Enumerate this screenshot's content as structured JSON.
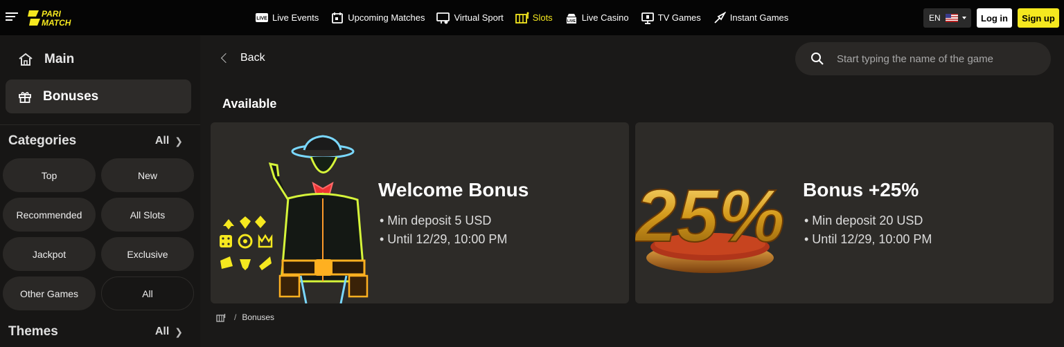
{
  "header": {
    "logo_text_line1": "PARI",
    "logo_text_line2": "MATCH",
    "nav": [
      {
        "label": "Live Events",
        "icon": "live-icon",
        "active": false
      },
      {
        "label": "Upcoming Matches",
        "icon": "calendar-icon",
        "active": false
      },
      {
        "label": "Virtual Sport",
        "icon": "virtual-sport-icon",
        "active": false
      },
      {
        "label": "Slots",
        "icon": "slots-icon",
        "active": true
      },
      {
        "label": "Live Casino",
        "icon": "live-casino-icon",
        "active": false
      },
      {
        "label": "TV Games",
        "icon": "tv-games-icon",
        "active": false
      },
      {
        "label": "Instant Games",
        "icon": "instant-games-icon",
        "active": false
      }
    ],
    "language": "EN",
    "login_label": "Log in",
    "signup_label": "Sign up",
    "accent_color": "#f5e81f"
  },
  "sidebar": {
    "main_label": "Main",
    "bonuses_label": "Bonuses",
    "categories_title": "Categories",
    "categories_all": "All",
    "categories": [
      "Top",
      "New",
      "Recommended",
      "All Slots",
      "Jackpot",
      "Exclusive",
      "Other Games",
      "All"
    ],
    "themes_title": "Themes",
    "themes_all": "All"
  },
  "main": {
    "back_label": "Back",
    "search_placeholder": "Start typing the name of the game",
    "section_title": "Available",
    "bonuses": [
      {
        "title": "Welcome Bonus",
        "lines": [
          "• Min deposit 5 USD",
          "• Until 12/29, 10:00 PM"
        ]
      },
      {
        "title": "Bonus +25%",
        "badge": "25%",
        "lines": [
          "• Min deposit 20 USD",
          "• Until 12/29, 10:00 PM"
        ]
      }
    ],
    "breadcrumb": [
      "Bonuses"
    ]
  }
}
